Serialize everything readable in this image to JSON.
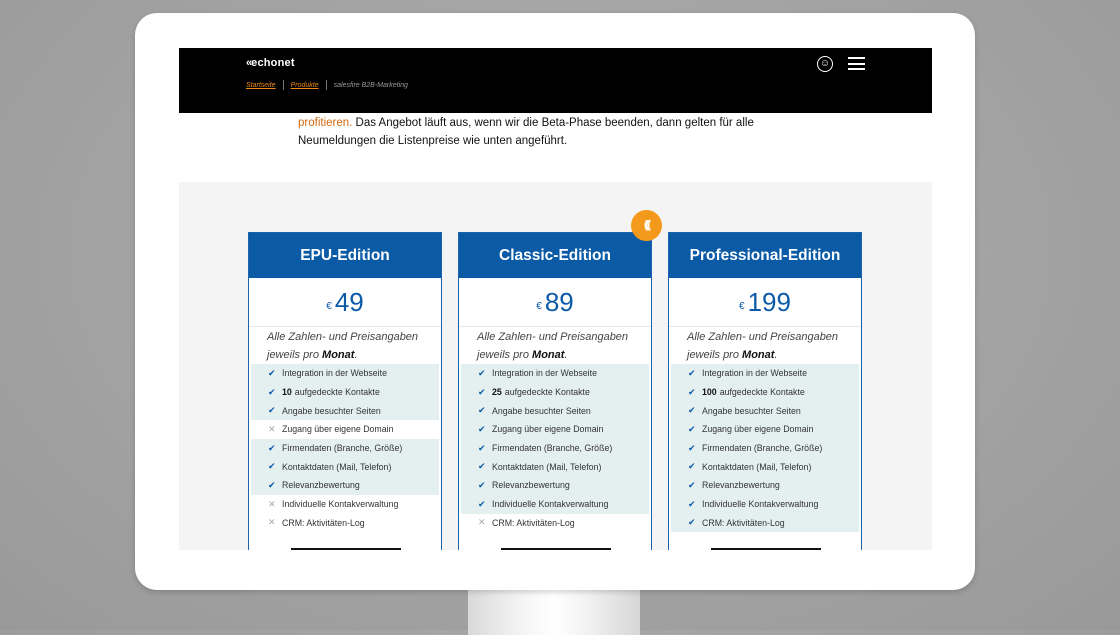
{
  "header": {
    "logo_mark": "«",
    "logo_text": "echonet",
    "breadcrumb": [
      "Startseite",
      "Produkte",
      "salesfire B2B-Marketing"
    ]
  },
  "intro": {
    "part1": "profitieren.",
    "part2": " Das Angebot läuft aus, wenn wir die Beta-Phase beenden, dann gelten für alle Neumeldungen die Listenpreise wie unten angeführt."
  },
  "badge_text": "(((",
  "note": {
    "prefix": "Alle Zahlen- und Preisangaben jeweils pro ",
    "emph": "Monat",
    "suffix": "."
  },
  "plans": [
    {
      "name": "EPU-Edition",
      "currency": "€",
      "price": "49",
      "features": [
        {
          "label": "Integration in der Webseite",
          "included": true
        },
        {
          "value": "10",
          "label": "aufgedeckte Kontakte",
          "included": true
        },
        {
          "label": "Angabe besuchter Seiten",
          "included": true
        },
        {
          "label": "Zugang über eigene Domain",
          "included": false
        },
        {
          "label": "Firmendaten (Branche, Größe)",
          "included": true
        },
        {
          "label": "Kontaktdaten (Mail, Telefon)",
          "included": true
        },
        {
          "label": "Relevanzbewertung",
          "included": true
        },
        {
          "label": "Individuelle Kontakverwaltung",
          "included": false
        },
        {
          "label": "CRM: Aktivitäten-Log",
          "included": false
        }
      ]
    },
    {
      "name": "Classic-Edition",
      "currency": "€",
      "price": "89",
      "features": [
        {
          "label": "Integration in der Webseite",
          "included": true
        },
        {
          "value": "25",
          "label": "aufgedeckte Kontakte",
          "included": true
        },
        {
          "label": "Angabe besuchter Seiten",
          "included": true
        },
        {
          "label": "Zugang über eigene Domain",
          "included": true
        },
        {
          "label": "Firmendaten (Branche, Größe)",
          "included": true
        },
        {
          "label": "Kontaktdaten (Mail, Telefon)",
          "included": true
        },
        {
          "label": "Relevanzbewertung",
          "included": true
        },
        {
          "label": "Individuelle Kontakverwaltung",
          "included": true
        },
        {
          "label": "CRM: Aktivitäten-Log",
          "included": false
        }
      ]
    },
    {
      "name": "Professional-Edition",
      "currency": "€",
      "price": "199",
      "features": [
        {
          "label": "Integration in der Webseite",
          "included": true
        },
        {
          "value": "100",
          "label": "aufgedeckte Kontakte",
          "included": true
        },
        {
          "label": "Angabe besuchter Seiten",
          "included": true
        },
        {
          "label": "Zugang über eigene Domain",
          "included": true
        },
        {
          "label": "Firmendaten (Branche, Größe)",
          "included": true
        },
        {
          "label": "Kontaktdaten (Mail, Telefon)",
          "included": true
        },
        {
          "label": "Relevanzbewertung",
          "included": true
        },
        {
          "label": "Individuelle Kontakverwaltung",
          "included": true
        },
        {
          "label": "CRM: Aktivitäten-Log",
          "included": true
        }
      ]
    }
  ],
  "icons": {
    "included": "check-icon",
    "excluded": "cross-icon",
    "accessibility": "accessibility-icon",
    "menu": "hamburger-menu-icon"
  },
  "colors": {
    "brand_blue": "#0a5aa6",
    "accent_orange": "#f39a1c",
    "feature_highlight": "#e4f0ef"
  }
}
